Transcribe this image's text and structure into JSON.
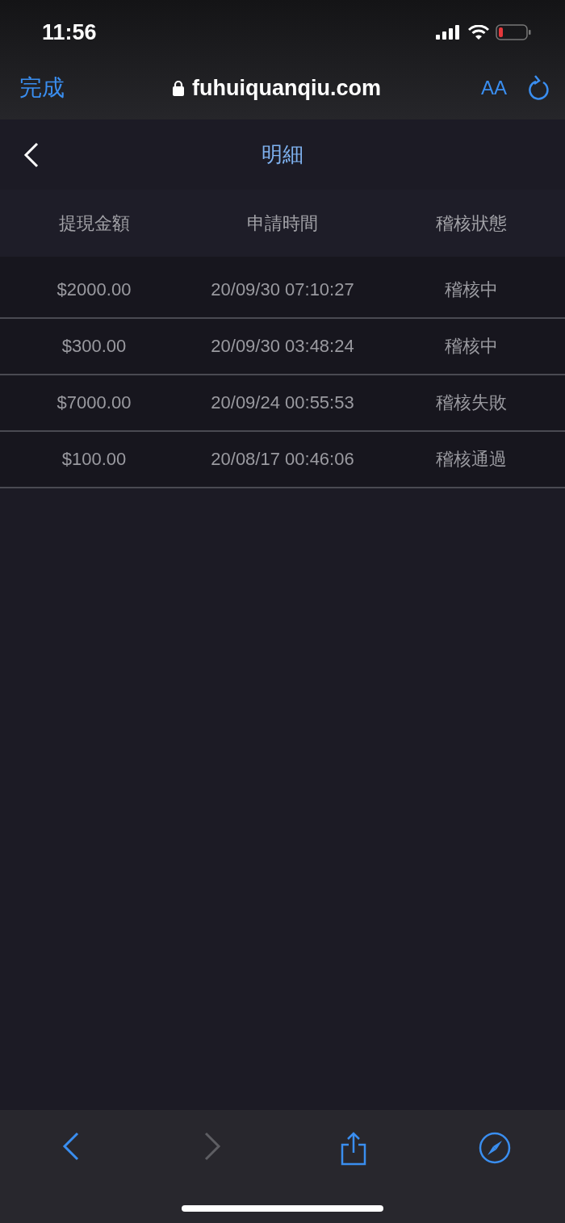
{
  "status_bar": {
    "time": "11:56"
  },
  "browser_bar": {
    "done": "完成",
    "url": "fuhuiquanqiu.com",
    "text_size": "AA"
  },
  "header": {
    "title": "明細"
  },
  "table": {
    "columns": [
      "提現金額",
      "申請時間",
      "稽核狀態"
    ],
    "rows": [
      {
        "amount": "$2000.00",
        "time": "20/09/30 07:10:27",
        "status": "稽核中"
      },
      {
        "amount": "$300.00",
        "time": "20/09/30 03:48:24",
        "status": "稽核中"
      },
      {
        "amount": "$7000.00",
        "time": "20/09/24 00:55:53",
        "status": "稽核失敗"
      },
      {
        "amount": "$100.00",
        "time": "20/08/17 00:46:06",
        "status": "稽核通過"
      }
    ]
  },
  "toolbar": {
    "back_disabled": false,
    "forward_disabled": true
  }
}
